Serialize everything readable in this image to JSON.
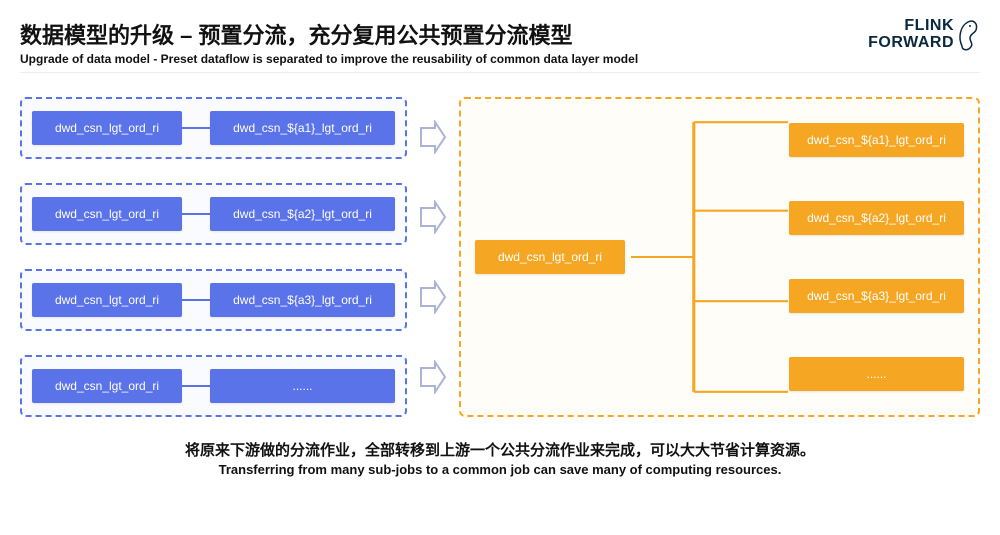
{
  "header": {
    "title_zh": "数据模型的升级 – 预置分流，充分复用公共预置分流模型",
    "title_en": "Upgrade of data model - Preset dataflow is separated to improve the reusability of common data layer model",
    "logo_line1": "FLINK",
    "logo_line2": "FORWARD"
  },
  "left": {
    "rows": [
      {
        "src": "dwd_csn_lgt_ord_ri",
        "dst": "dwd_csn_${a1}_lgt_ord_ri"
      },
      {
        "src": "dwd_csn_lgt_ord_ri",
        "dst": "dwd_csn_${a2}_lgt_ord_ri"
      },
      {
        "src": "dwd_csn_lgt_ord_ri",
        "dst": "dwd_csn_${a3}_lgt_ord_ri"
      },
      {
        "src": "dwd_csn_lgt_ord_ri",
        "dst": "......"
      }
    ]
  },
  "right": {
    "src": "dwd_csn_lgt_ord_ri",
    "targets": [
      "dwd_csn_${a1}_lgt_ord_ri",
      "dwd_csn_${a2}_lgt_ord_ri",
      "dwd_csn_${a3}_lgt_ord_ri",
      "......"
    ]
  },
  "footer": {
    "zh": "将原来下游做的分流作业，全部转移到上游一个公共分流作业来完成，可以大大节省计算资源。",
    "en": "Transferring from many sub-jobs to a common job can save many of computing resources."
  },
  "colors": {
    "blue": "#5b73e8",
    "orange": "#f5a623"
  }
}
